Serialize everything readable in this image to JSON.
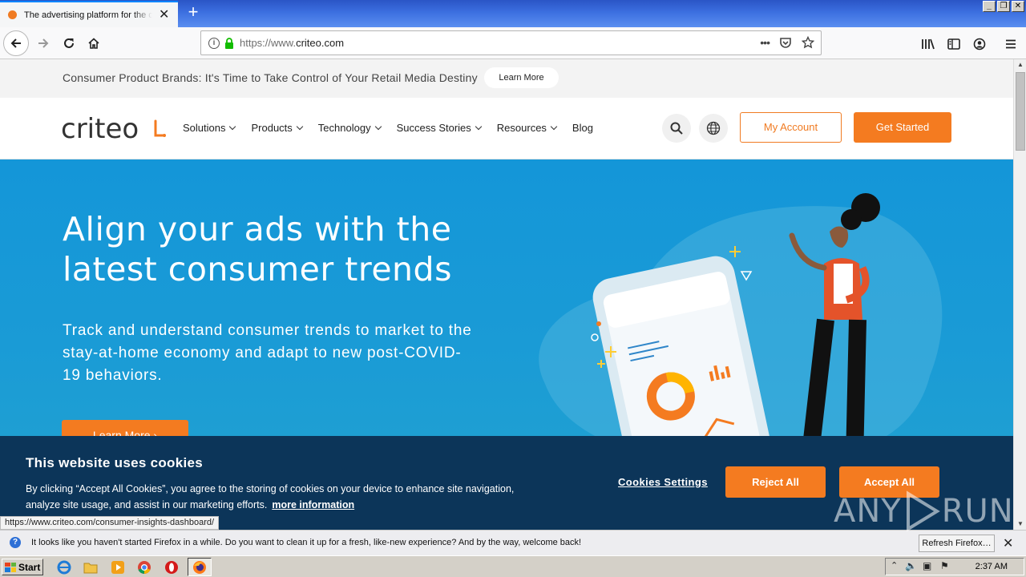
{
  "browser": {
    "tab_title": "The advertising platform for the open internet",
    "url_protocol": "https://www.",
    "url_host": "criteo.com",
    "status_url": "https://www.criteo.com/consumer-insights-dashboard/"
  },
  "promo": {
    "text": "Consumer Product Brands: It's Time to Take Control of Your Retail Media Destiny",
    "button": "Learn More"
  },
  "header": {
    "logo": "criteo",
    "nav": [
      "Solutions",
      "Products",
      "Technology",
      "Success Stories",
      "Resources",
      "Blog"
    ],
    "my_account": "My Account",
    "get_started": "Get Started"
  },
  "hero": {
    "title": "Align your ads with the latest consumer trends",
    "subtitle": "Track and understand consumer trends to market to the stay-at-home economy and adapt to new post-COVID-19 behaviors.",
    "button": "Learn More"
  },
  "cookie": {
    "title": "This website uses cookies",
    "body": "By clicking “Accept All Cookies”, you agree to the storing of cookies on your device to enhance site navigation, analyze site usage, and assist in our marketing efforts.",
    "more": "more information",
    "settings": "Cookies Settings",
    "reject": "Reject All",
    "accept": "Accept All"
  },
  "notification": {
    "text": "It looks like you haven't started Firefox in a while. Do you want to clean it up for a fresh, like-new experience? And by the way, welcome back!",
    "button": "Refresh Firefox…"
  },
  "taskbar": {
    "start": "Start",
    "clock": "2:37 AM"
  },
  "watermark": {
    "left": "ANY",
    "right": "RUN"
  },
  "colors": {
    "brand_orange": "#f47b20",
    "hero_blue": "#1a9bd6",
    "cookie_bg": "#0c3559"
  }
}
